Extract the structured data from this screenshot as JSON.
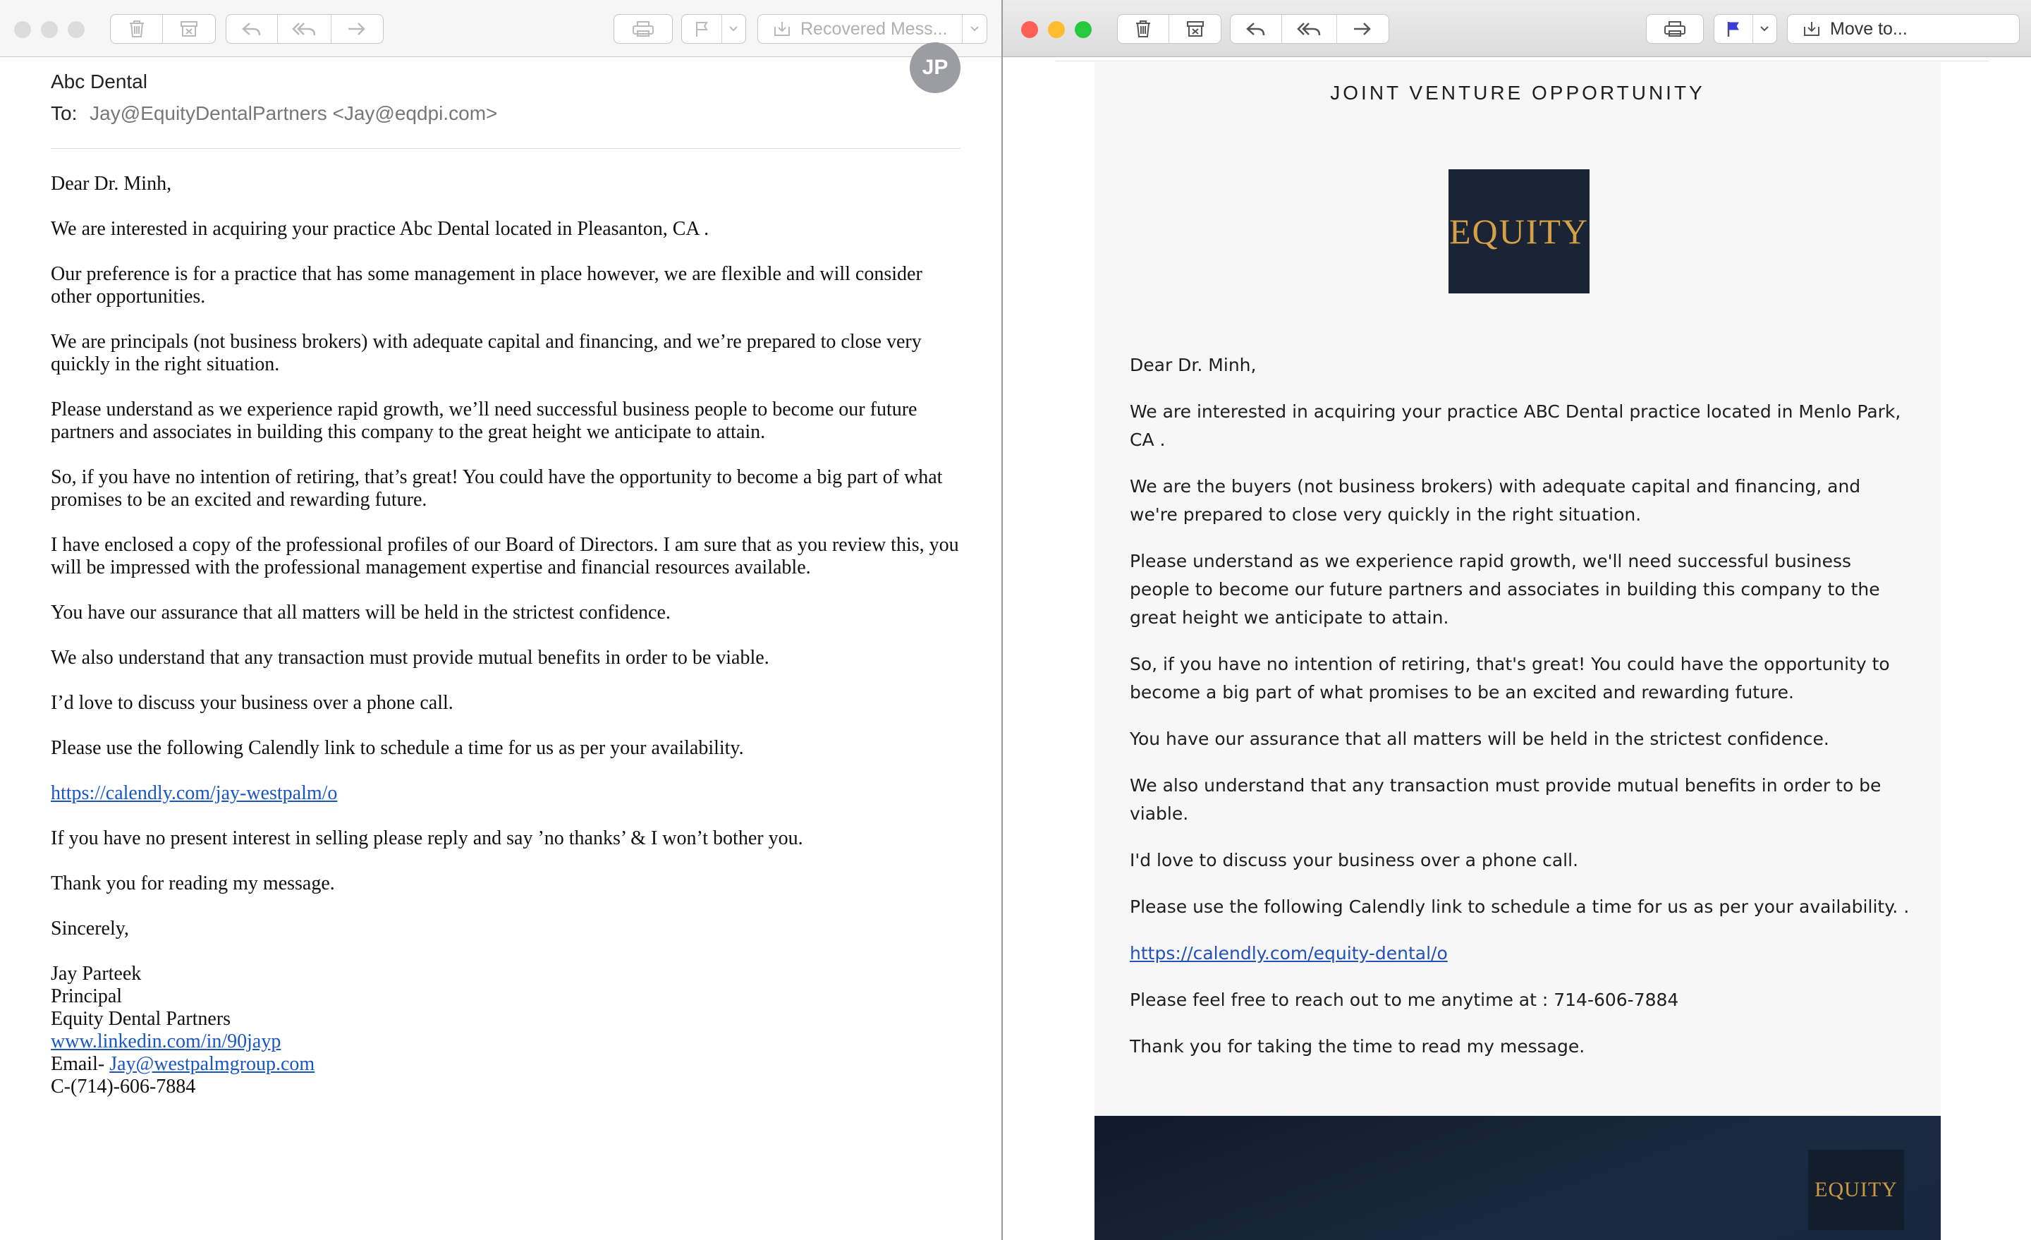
{
  "left_window": {
    "toolbar": {
      "move_label": "Recovered Mess..."
    },
    "header": {
      "subject": "Abc Dental",
      "to_label": "To:",
      "to_value": "Jay@EquityDentalPartners <Jay@eqdpi.com>",
      "avatar_initials": "JP"
    },
    "body": {
      "paragraphs": [
        "Dear Dr. Minh,",
        "We are interested in acquiring your practice Abc Dental  located in Pleasanton, CA .",
        "Our preference is for a practice that has some management in place however, we are flexible and will consider other opportunities.",
        "We are principals (not business brokers) with adequate capital and financing, and we’re prepared to close very quickly in the right situation.",
        "Please understand as we experience rapid growth, we’ll need successful business people to become our future partners and associates in building this company to the great height we anticipate to attain.",
        "So, if you have no intention of retiring, that’s great!  You could have the opportunity to become a big part of what promises to be an excited and rewarding future.",
        "I have enclosed a copy of the professional profiles of our Board of Directors. I am sure that as you review this, you will be impressed with the professional management expertise and financial resources available.",
        "You have our assurance that all matters will be held in the strictest confidence.",
        "We also understand that any transaction must provide mutual benefits in order to be viable.",
        "I’d love to discuss your business over a phone call.",
        "Please use the following Calendly link to schedule a time for us as per your availability."
      ],
      "calendly_link": "https://calendly.com/jay-westpalm/o",
      "after_link": [
        "If you have no present interest in selling please reply and say ’no thanks’ & I won’t bother you.",
        "Thank you for reading my message.",
        "Sincerely,"
      ],
      "signature": {
        "name": "Jay Parteek",
        "title": "Principal",
        "company": "Equity Dental Partners",
        "linkedin": "www.linkedin.com/in/90jayp",
        "email_prefix": "Email- ",
        "email": "Jay@westpalmgroup.com",
        "phone": "C-(714)-606-7884"
      }
    }
  },
  "right_window": {
    "toolbar": {
      "move_label": "Move to..."
    },
    "card": {
      "title": "JOINT VENTURE OPPORTUNITY",
      "logo_text": "EQUITY",
      "paragraphs": [
        "Dear Dr. Minh,",
        "We are interested in acquiring your practice ABC Dental practice located in Menlo Park, CA .",
        "We are the buyers (not business brokers) with adequate capital and financing, and we're prepared to close very quickly in the right situation.",
        "Please understand as we experience rapid growth, we'll need successful business people to become our future partners and associates in building this company to the great height we anticipate to attain.",
        "So, if you have no intention of retiring, that's great! You could have the opportunity to become a big part of what promises to be an excited and rewarding future.",
        "You have our assurance that all matters will be held in the strictest confidence.",
        "We also understand that any transaction must provide mutual benefits in order to be viable.",
        "I'd love to discuss your business over a phone call.",
        "Please use the following Calendly link to schedule a time for us as per your availability. ."
      ],
      "calendly_link": "https://calendly.com/equity-dental/o",
      "contact_line": "Please feel free to reach out to me anytime at : 714-606-7884",
      "closing": "Thank you for taking the time to read my message.",
      "footer_logo_text": "EQUITY"
    }
  },
  "colors": {
    "close_light": "#fe5f57",
    "minimize_light": "#febc2e",
    "zoom_light": "#28c840",
    "inactive_light": "#dcdcdc",
    "link": "#1a55c4",
    "logo_bg": "#1b2434",
    "logo_gold": "#d4a147"
  }
}
